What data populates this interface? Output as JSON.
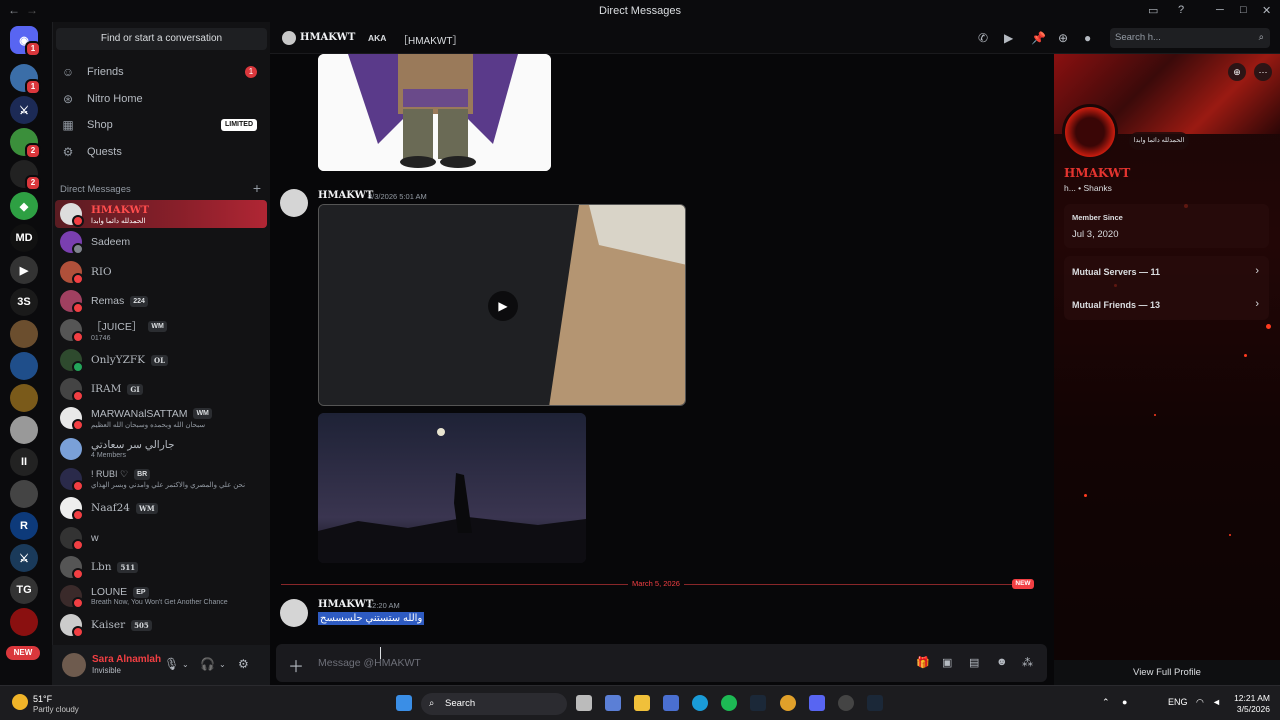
{
  "window": {
    "title": "Direct Messages",
    "back": "←",
    "forward": "→"
  },
  "servers": {
    "badges": [
      "1",
      "1",
      "2",
      "2"
    ],
    "labels": [
      "MD",
      "3S",
      "R",
      "TG"
    ],
    "new_label": "NEW"
  },
  "sidebar": {
    "find_placeholder": "Find or start a conversation",
    "nav": [
      {
        "label": "Friends",
        "badge": "1"
      },
      {
        "label": "Nitro Home"
      },
      {
        "label": "Shop",
        "tag": "LIMITED"
      },
      {
        "label": "Quests"
      }
    ],
    "dm_header": "Direct Messages",
    "dms": [
      {
        "name": "HMAKWT",
        "sub": "الحمدلله دائما وابدا",
        "active": true
      },
      {
        "name": "Sadeem"
      },
      {
        "name": "RIO"
      },
      {
        "name": "Remas",
        "tag": "224"
      },
      {
        "name": "［JUICE］",
        "tag": "WM",
        "sub": "01746"
      },
      {
        "name": "OnlyYZFK",
        "tag": "OL"
      },
      {
        "name": "IRAM",
        "tag": "GI"
      },
      {
        "name": "MARWANalSATTAM",
        "tag": "WM",
        "sub": "سبحان الله وبحمده وسبحان الله العظيم"
      },
      {
        "name": "جارالي سر سعادتي",
        "sub": "4 Members"
      },
      {
        "name": "! RUBI ♡",
        "tag": "BR",
        "sub": "نحن علي والمصري والاكتمر علي وامدني وبسر الهذاي"
      },
      {
        "name": "Naaf24",
        "tag": "WM"
      },
      {
        "name": "w"
      },
      {
        "name": "Lbn",
        "tag": "511"
      },
      {
        "name": "LOUNE",
        "tag": "EP",
        "sub": "Breath Now, You Won't Get Another Chance"
      },
      {
        "name": "Kaiser",
        "tag": "505"
      }
    ]
  },
  "user": {
    "name": "Sara Alnamlah",
    "status": "Invisible"
  },
  "header": {
    "name": "HMAKWT",
    "aka_label": "AKA",
    "aka_value": "［HMAKWT］",
    "search_placeholder": "Search h..."
  },
  "messages": [
    {
      "author": "HMAKWT",
      "time": "3/3/2026 5:01 AM"
    },
    {
      "author": "HMAKWT",
      "time": "12:20 AM",
      "text": "والله ستستني حلسسسح"
    }
  ],
  "divider": {
    "date": "March 5, 2026",
    "new_label": "NEW"
  },
  "composer": {
    "placeholder": "Message @HMAKWT"
  },
  "profile": {
    "name": "HMAKWT",
    "subtitle": "h... • Shanks",
    "bubble": "الحمدلله دائما وابدا",
    "member_since_label": "Member Since",
    "member_since": "Jul 3, 2020",
    "mutual_servers": "Mutual Servers — 11",
    "mutual_friends": "Mutual Friends — 13",
    "view_full": "View Full Profile"
  },
  "taskbar": {
    "temp": "51°F",
    "condition": "Partly cloudy",
    "search": "Search",
    "lang": "ENG",
    "time": "12:21 AM",
    "date": "3/5/2026"
  },
  "colors": {
    "accent": "#f23f43",
    "selection": "#2e5bc2",
    "background": "#070709"
  }
}
